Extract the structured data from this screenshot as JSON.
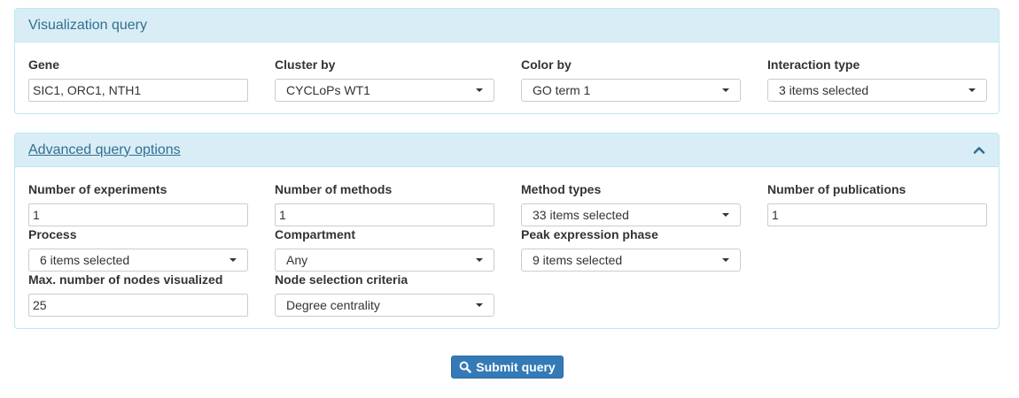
{
  "visualization_panel": {
    "title": "Visualization query",
    "gene": {
      "label": "Gene",
      "value": "SIC1, ORC1, NTH1"
    },
    "cluster_by": {
      "label": "Cluster by",
      "value": "CYCLoPs WT1"
    },
    "color_by": {
      "label": "Color by",
      "value": "GO term 1"
    },
    "interaction_type": {
      "label": "Interaction type",
      "value": "3 items selected"
    }
  },
  "advanced_panel": {
    "title": "Advanced query options",
    "collapse_icon": "chevron-up-icon",
    "num_experiments": {
      "label": "Number of experiments",
      "value": "1"
    },
    "num_methods": {
      "label": "Number of methods",
      "value": "1"
    },
    "method_types": {
      "label": "Method types",
      "value": "33 items selected"
    },
    "num_publications": {
      "label": "Number of publications",
      "value": "1"
    },
    "process": {
      "label": "Process",
      "value": "6 items selected"
    },
    "compartment": {
      "label": "Compartment",
      "value": "Any"
    },
    "peak_expression": {
      "label": "Peak expression phase",
      "value": "9 items selected"
    },
    "max_nodes": {
      "label": "Max. number of nodes visualized",
      "value": "25"
    },
    "node_selection": {
      "label": "Node selection criteria",
      "value": "Degree centrality"
    }
  },
  "submit": {
    "label": "Submit query",
    "icon": "search-icon"
  },
  "colors": {
    "primary": "#337ab7",
    "panel_heading_bg": "#d9edf7",
    "panel_border": "#bce8f1",
    "panel_title": "#31708f"
  }
}
